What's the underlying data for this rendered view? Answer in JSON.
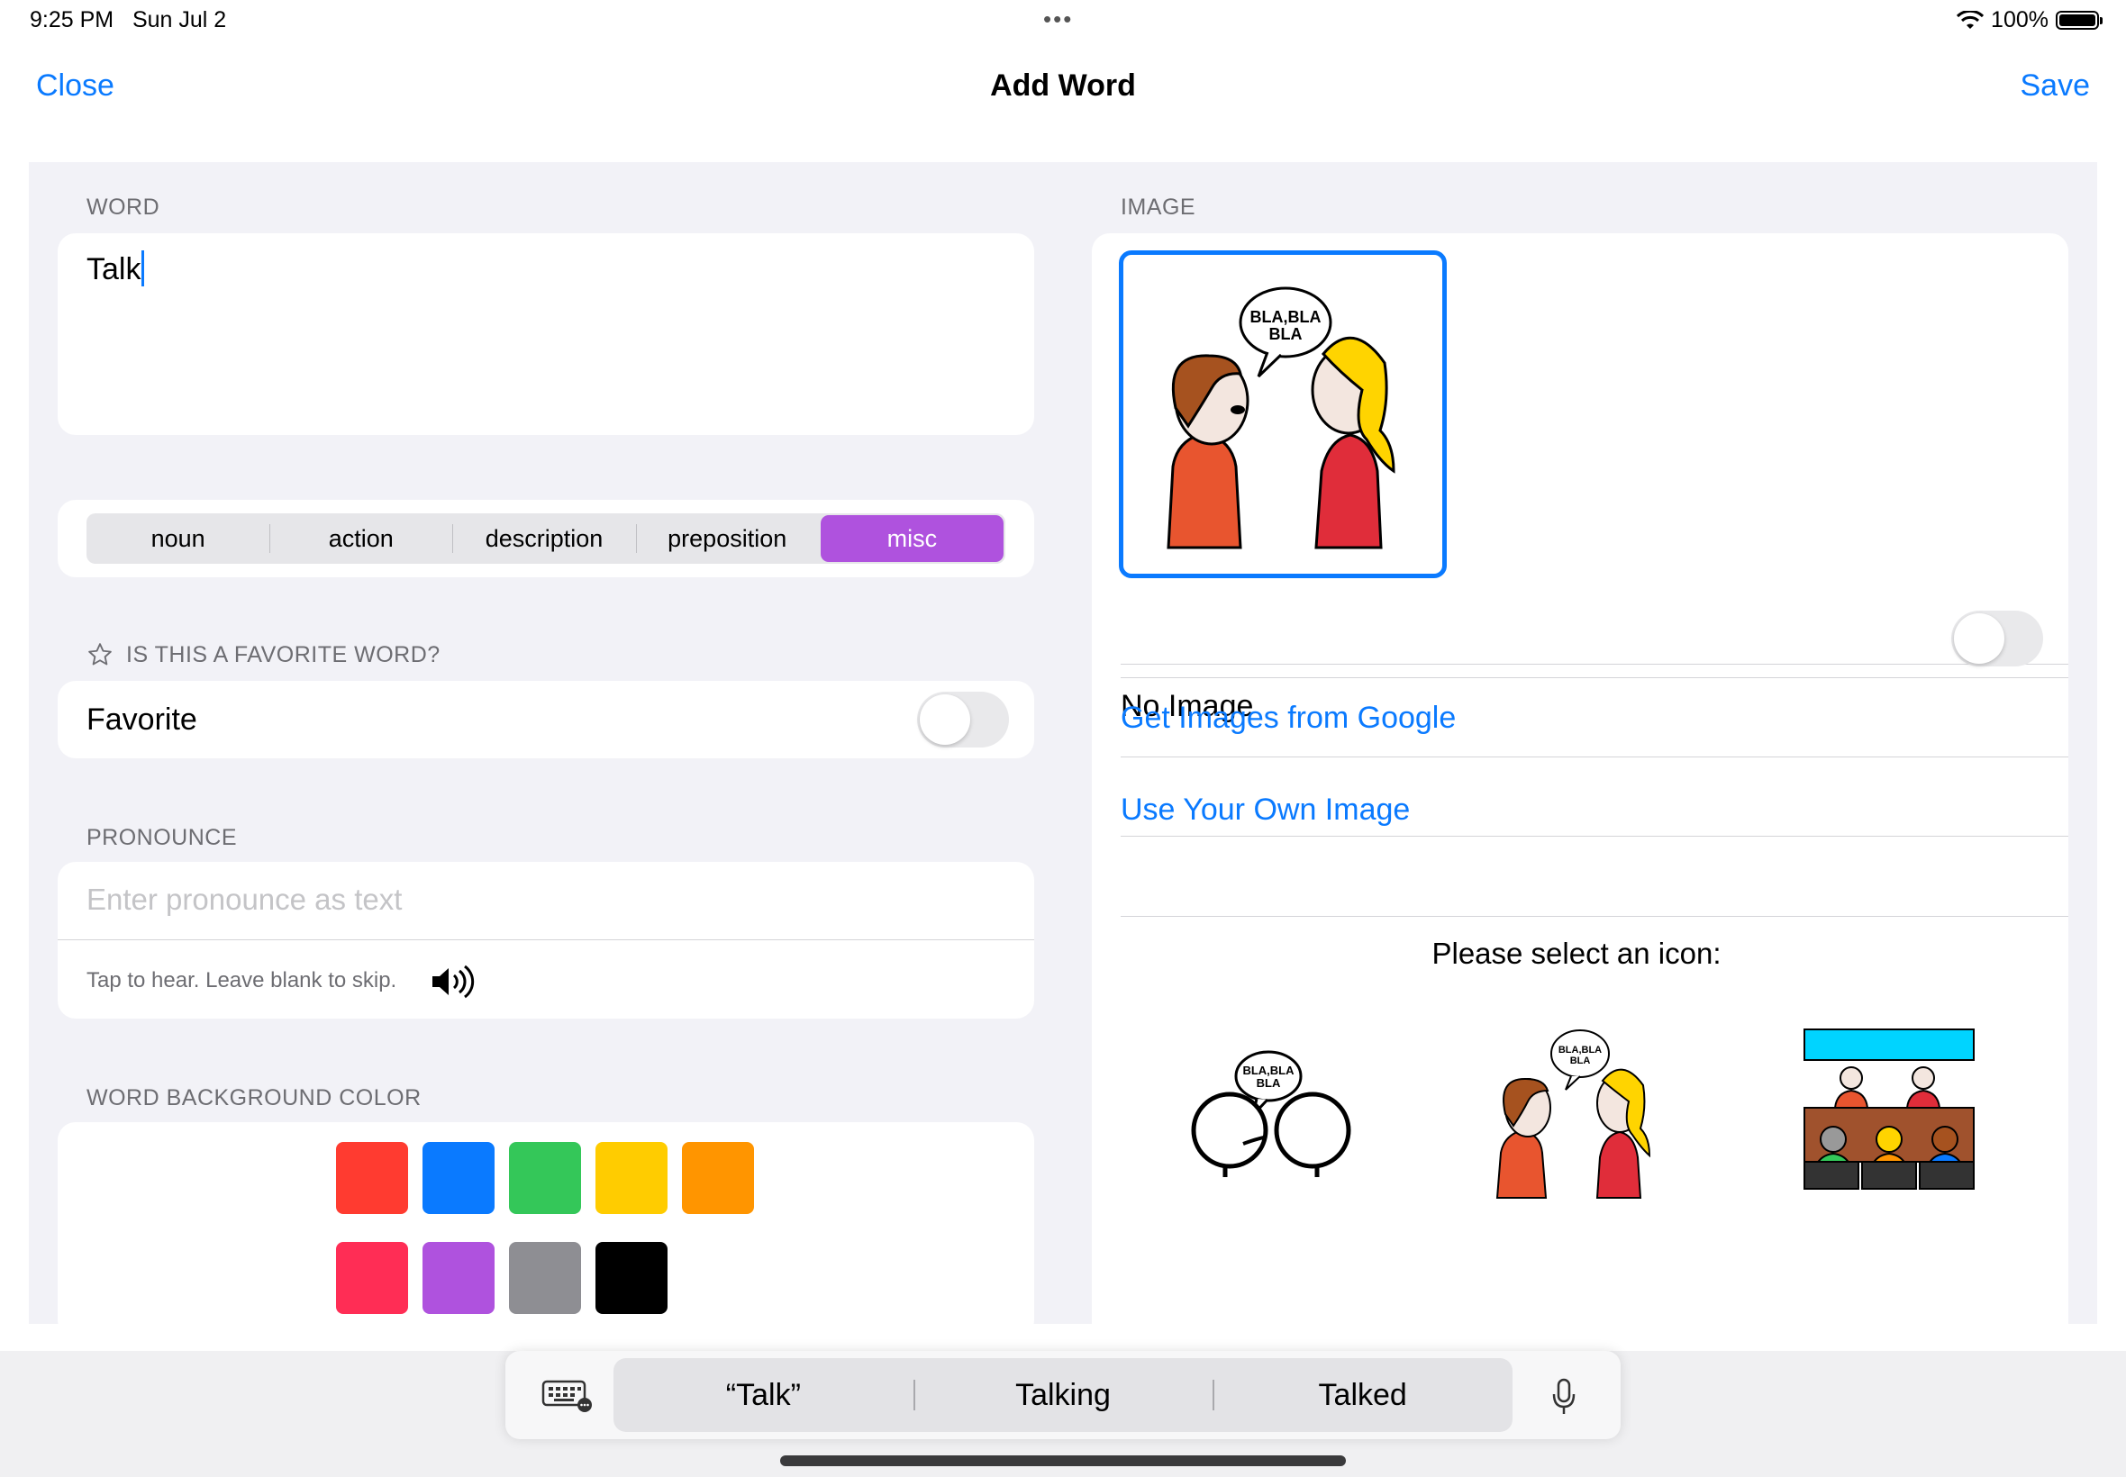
{
  "status": {
    "time": "9:25 PM",
    "date": "Sun Jul 2",
    "dots": "•••",
    "battery": "100%"
  },
  "nav": {
    "close": "Close",
    "title": "Add Word",
    "save": "Save"
  },
  "word": {
    "header": "WORD",
    "value": "Talk"
  },
  "category": {
    "options": [
      "noun",
      "action",
      "description",
      "preposition",
      "misc"
    ],
    "selected": "misc",
    "selected_color": "#af52de"
  },
  "favorite": {
    "header": "IS THIS A FAVORITE WORD?",
    "label": "Favorite",
    "on": false
  },
  "pronounce": {
    "header": "PRONOUNCE",
    "placeholder": "Enter pronounce as text",
    "hint": "Tap to hear. Leave blank to skip."
  },
  "background_color": {
    "header": "WORD BACKGROUND COLOR",
    "colors": [
      "#ff3b30",
      "#0a7aff",
      "#34c759",
      "#ffcc00",
      "#ff9500",
      "#ff2d55",
      "#af52de",
      "#8e8e93",
      "#000000"
    ]
  },
  "image": {
    "header": "IMAGE",
    "bubble_text_1": "BLA,BLA",
    "bubble_text_2": "BLA",
    "no_image_label": "No Image",
    "no_image_on": false,
    "google_link": "Get Images from Google",
    "own_image_link": "Use Your Own Image",
    "icon_prompt": "Please select an icon:"
  },
  "keyboard": {
    "suggestions": [
      "“Talk”",
      "Talking",
      "Talked"
    ]
  }
}
